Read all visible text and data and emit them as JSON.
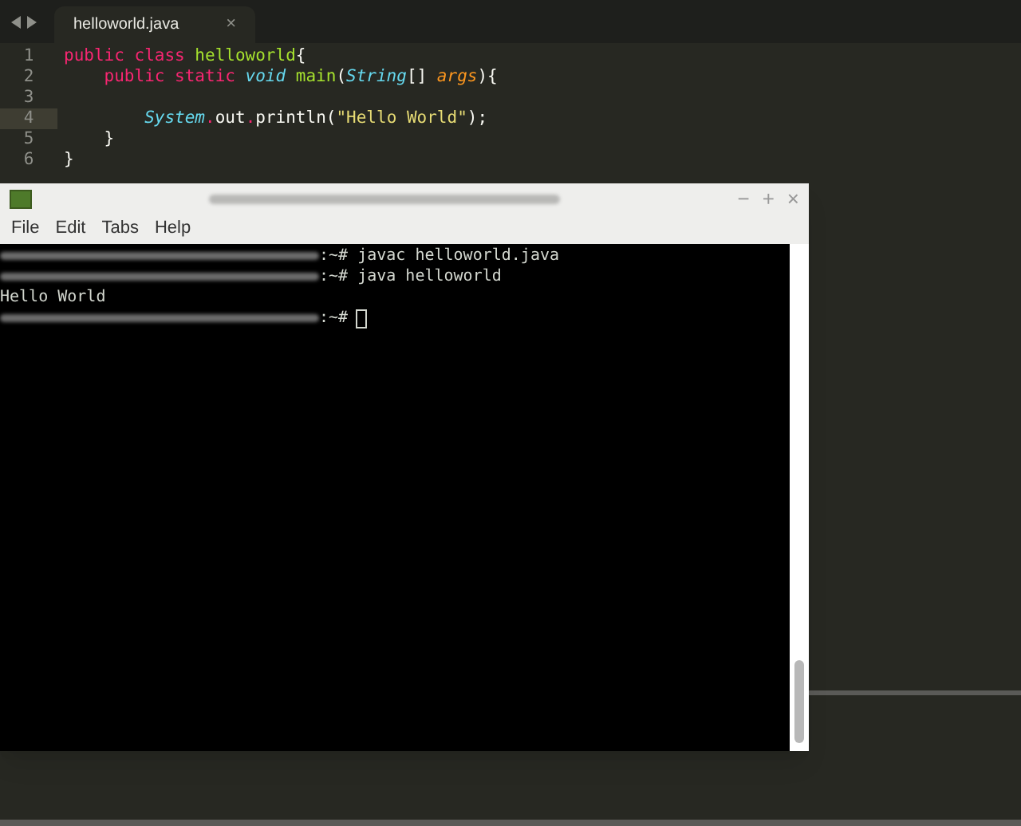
{
  "editor": {
    "tabs": [
      {
        "label": "helloworld.java",
        "close": "×",
        "selected": true
      }
    ],
    "lines": [
      {
        "number": "1",
        "selected": false,
        "tokens": [
          {
            "kind": "keyword",
            "text": "public class"
          },
          {
            "kind": "name",
            "text": " helloworld"
          },
          {
            "kind": "plain",
            "text": "{"
          }
        ]
      },
      {
        "number": "2",
        "selected": false,
        "tokens": [
          {
            "kind": "keyword",
            "text": "    public static"
          },
          {
            "kind": "type",
            "text": " void"
          },
          {
            "kind": "name",
            "text": " main"
          },
          {
            "kind": "plain",
            "text": "("
          },
          {
            "kind": "type",
            "text": "String"
          },
          {
            "kind": "plain",
            "text": "[] "
          },
          {
            "kind": "param",
            "text": "args"
          },
          {
            "kind": "plain",
            "text": "){"
          }
        ]
      },
      {
        "number": "3",
        "selected": false
      },
      {
        "number": "4",
        "selected": true,
        "tokens": [
          {
            "kind": "type",
            "text": "        System"
          },
          {
            "kind": "keyword",
            "text": "."
          },
          {
            "kind": "plain",
            "text": "out"
          },
          {
            "kind": "keyword",
            "text": "."
          },
          {
            "kind": "plain",
            "text": "println("
          },
          {
            "kind": "string",
            "text": "\"Hello World\""
          },
          {
            "kind": "plain",
            "text": ");"
          }
        ]
      },
      {
        "number": "5",
        "selected": false,
        "tokens": [
          {
            "kind": "plain",
            "text": "    }"
          }
        ]
      },
      {
        "number": "6",
        "selected": false,
        "tokens": [
          {
            "kind": "plain",
            "text": "}"
          }
        ]
      }
    ]
  },
  "terminal": {
    "menu": [
      "File",
      "Edit",
      "Tabs",
      "Help"
    ],
    "window_buttons": [
      "−",
      "+",
      "×"
    ],
    "lines": [
      {
        "kind": "prompt",
        "text": ":~# javac helloworld.java"
      },
      {
        "kind": "prompt",
        "text": ":~# java helloworld"
      },
      {
        "kind": "output",
        "text": "Hello World"
      },
      {
        "kind": "cursor",
        "text": ":~#"
      }
    ]
  }
}
